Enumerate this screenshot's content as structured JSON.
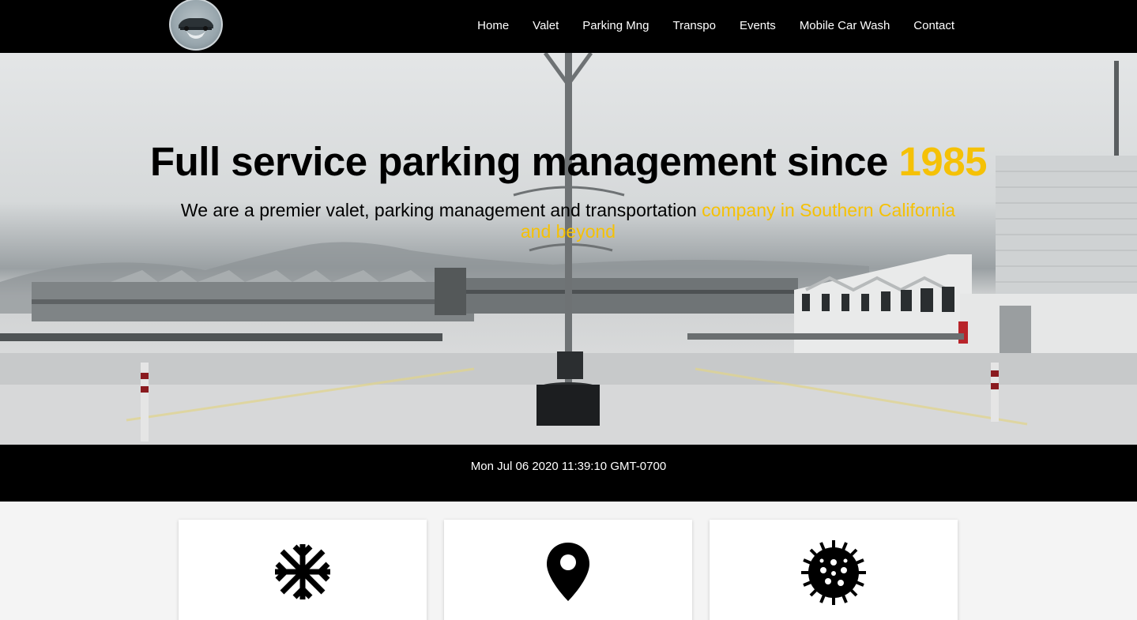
{
  "nav": {
    "items": [
      "Home",
      "Valet",
      "Parking Mng",
      "Transpo",
      "Events",
      "Mobile Car Wash",
      "Contact"
    ]
  },
  "hero": {
    "title_main": "Full service parking management since ",
    "title_accent": "1985",
    "subtitle_main": "We are a premier valet, parking management and transportation ",
    "subtitle_accent": "company in Southern California and beyond"
  },
  "clock": "Mon Jul 06 2020 11:39:10 GMT-0700",
  "cards": [
    {
      "icon": "snowflake-icon"
    },
    {
      "icon": "map-pin-icon"
    },
    {
      "icon": "virus-icon"
    }
  ],
  "colors": {
    "accent": "#f5c106",
    "navbar": "#000000",
    "page_bg": "#f4f4f4"
  }
}
